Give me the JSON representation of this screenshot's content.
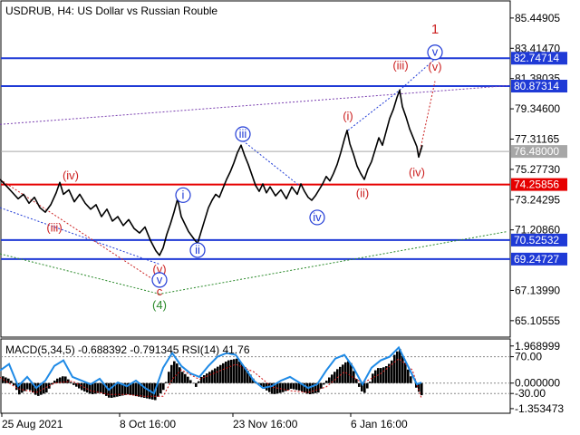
{
  "chart_data": [
    {
      "type": "line",
      "title": "USDRUB, H4:  US Dollar vs Russian Rouble",
      "ylim": [
        64.0,
        86.6
      ],
      "grid": false,
      "y_ticks": [
        "85.44905",
        "83.41470",
        "81.38035",
        "79.34600",
        "77.31165",
        "75.27730",
        "73.24295",
        "71.20860",
        "67.13990",
        "65.10555"
      ],
      "x_ticks": [
        "25 Aug 2021",
        "8 Oct 16:00",
        "23 Nov 16:00",
        "6 Jan 16:00"
      ],
      "series": [
        {
          "values": [
            [
              0,
              74.6
            ],
            [
              8,
              74.1
            ],
            [
              14,
              73.7
            ],
            [
              20,
              73.3
            ],
            [
              26,
              73.6
            ],
            [
              32,
              73.0
            ],
            [
              38,
              73.4
            ],
            [
              44,
              72.7
            ],
            [
              50,
              72.4
            ],
            [
              56,
              72.9
            ],
            [
              62,
              73.7
            ],
            [
              66,
              74.4
            ],
            [
              70,
              73.6
            ],
            [
              76,
              73.9
            ],
            [
              82,
              73.1
            ],
            [
              88,
              73.6
            ],
            [
              94,
              73.0
            ],
            [
              100,
              72.6
            ],
            [
              106,
              72.9
            ],
            [
              112,
              72.1
            ],
            [
              118,
              72.6
            ],
            [
              124,
              71.8
            ],
            [
              130,
              72.1
            ],
            [
              136,
              71.5
            ],
            [
              142,
              71.9
            ],
            [
              148,
              71.3
            ],
            [
              154,
              71.0
            ],
            [
              160,
              71.4
            ],
            [
              166,
              70.5
            ],
            [
              172,
              69.8
            ],
            [
              176,
              69.5
            ],
            [
              180,
              70.0
            ],
            [
              184,
              70.9
            ],
            [
              188,
              71.6
            ],
            [
              192,
              72.4
            ],
            [
              196,
              73.3
            ],
            [
              200,
              72.1
            ],
            [
              204,
              71.6
            ],
            [
              208,
              71.1
            ],
            [
              214,
              70.6
            ],
            [
              218,
              70.3
            ],
            [
              222,
              71.1
            ],
            [
              226,
              71.9
            ],
            [
              230,
              72.7
            ],
            [
              234,
              73.2
            ],
            [
              238,
              73.6
            ],
            [
              242,
              73.4
            ],
            [
              246,
              74.0
            ],
            [
              250,
              74.6
            ],
            [
              254,
              75.1
            ],
            [
              258,
              75.7
            ],
            [
              262,
              76.4
            ],
            [
              266,
              76.9
            ],
            [
              270,
              76.2
            ],
            [
              274,
              75.6
            ],
            [
              278,
              74.9
            ],
            [
              282,
              74.2
            ],
            [
              286,
              73.8
            ],
            [
              290,
              74.3
            ],
            [
              294,
              73.7
            ],
            [
              298,
              74.1
            ],
            [
              304,
              73.5
            ],
            [
              310,
              73.9
            ],
            [
              316,
              73.3
            ],
            [
              322,
              74.1
            ],
            [
              328,
              73.6
            ],
            [
              332,
              74.3
            ],
            [
              336,
              73.8
            ],
            [
              340,
              73.4
            ],
            [
              344,
              73.2
            ],
            [
              348,
              73.5
            ],
            [
              352,
              73.9
            ],
            [
              356,
              74.3
            ],
            [
              360,
              74.8
            ],
            [
              364,
              74.5
            ],
            [
              368,
              75.0
            ],
            [
              372,
              75.6
            ],
            [
              376,
              76.4
            ],
            [
              380,
              77.3
            ],
            [
              383,
              77.9
            ],
            [
              386,
              77.0
            ],
            [
              390,
              76.3
            ],
            [
              394,
              75.5
            ],
            [
              398,
              75.0
            ],
            [
              402,
              74.6
            ],
            [
              406,
              75.3
            ],
            [
              410,
              75.8
            ],
            [
              414,
              76.6
            ],
            [
              418,
              77.4
            ],
            [
              422,
              76.9
            ],
            [
              426,
              77.8
            ],
            [
              430,
              78.7
            ],
            [
              434,
              79.3
            ],
            [
              438,
              80.1
            ],
            [
              441,
              80.6
            ],
            [
              444,
              79.5
            ],
            [
              448,
              78.8
            ],
            [
              452,
              78.0
            ],
            [
              456,
              77.4
            ],
            [
              460,
              76.8
            ],
            [
              462,
              76.1
            ],
            [
              466,
              76.9
            ]
          ]
        }
      ],
      "horizontal_levels": [
        {
          "value": 82.74714,
          "label": "82.74714",
          "color": "#1f3ad6"
        },
        {
          "value": 80.87314,
          "label": "80.87314",
          "color": "#1f3ad6"
        },
        {
          "value": 76.48,
          "label": "76.48000",
          "color": "#a7a7a7"
        },
        {
          "value": 74.25856,
          "label": "74.25856",
          "color": "#e60000"
        },
        {
          "value": 70.52532,
          "label": "70.52532",
          "color": "#1f3ad6"
        },
        {
          "value": 69.24727,
          "label": "69.24727",
          "color": "#1f3ad6"
        }
      ],
      "wave_labels": [
        {
          "text": "1",
          "color": "#cc2222",
          "x": 480,
          "y": 84.4
        },
        {
          "text": "(iii)",
          "color": "#cc2222",
          "x": 442,
          "y": 82.0
        },
        {
          "text": "(v)",
          "color": "#cc2222",
          "x": 480,
          "y": 81.9
        },
        {
          "text": "v",
          "color": "#1f3ad6",
          "circled": true,
          "x": 480,
          "y": 82.9
        },
        {
          "text": "(i)",
          "color": "#cc2222",
          "x": 384,
          "y": 78.6
        },
        {
          "text": "(ii)",
          "color": "#cc2222",
          "x": 400,
          "y": 73.4
        },
        {
          "text": "(iv)",
          "color": "#cc2222",
          "x": 460,
          "y": 74.8
        },
        {
          "text": "iii",
          "color": "#1f3ad6",
          "circled": true,
          "x": 268,
          "y": 77.4
        },
        {
          "text": "i",
          "color": "#1f3ad6",
          "circled": true,
          "x": 202,
          "y": 73.3
        },
        {
          "text": "ii",
          "color": "#1f3ad6",
          "circled": true,
          "x": 218,
          "y": 69.6
        },
        {
          "text": "iv",
          "color": "#1f3ad6",
          "circled": true,
          "x": 350,
          "y": 71.8
        },
        {
          "text": "(iv)",
          "color": "#cc2222",
          "x": 78,
          "y": 74.6
        },
        {
          "text": "(iii)",
          "color": "#cc2222",
          "x": 60,
          "y": 71.1
        },
        {
          "text": "(v)",
          "color": "#cc2222",
          "x": 176,
          "y": 68.3
        },
        {
          "text": "v",
          "color": "#1f3ad6",
          "circled": true,
          "x": 176,
          "y": 67.6
        },
        {
          "text": "c",
          "color": "#cc2222",
          "x": 176,
          "y": 66.8
        },
        {
          "text": "(4)",
          "color": "#2a8a2a",
          "x": 176,
          "y": 65.9
        }
      ],
      "wave_lines": [
        {
          "color": "#1f3ad6",
          "points": [
            [
              268,
              77.2
            ],
            [
              330,
              74.2
            ]
          ]
        },
        {
          "color": "#1f3ad6",
          "points": [
            [
              0,
              72.7
            ],
            [
              176,
              68.9
            ]
          ]
        },
        {
          "color": "#cc2222",
          "points": [
            [
              0,
              74.6
            ],
            [
              176,
              67.6
            ]
          ]
        },
        {
          "color": "#2a8a2a",
          "points": [
            [
              0,
              69.6
            ],
            [
              176,
              66.9
            ],
            [
              560,
              71.1
            ]
          ]
        },
        {
          "color": "#7a3fb0",
          "points": [
            [
              0,
              78.3
            ],
            [
              560,
              80.9
            ]
          ]
        },
        {
          "color": "#1f3ad6",
          "points": [
            [
              384,
              77.9
            ],
            [
              441,
              80.6
            ],
            [
              480,
              82.7
            ]
          ]
        },
        {
          "color": "#cc2222",
          "points": [
            [
              462,
              76.1
            ],
            [
              480,
              81.2
            ]
          ]
        }
      ]
    },
    {
      "type": "bar",
      "title": "MACD(5,34,5) -0.688392 -0.791345 RSI(14) 41.76",
      "ylim": [
        -1.55,
        2.15
      ],
      "y_ticks": [
        "1.968999",
        "70.00",
        "0.000000",
        "-30.00",
        "-1.353473"
      ],
      "macd_values": [
        [
          0,
          0.4
        ],
        [
          10,
          0.2
        ],
        [
          20,
          -0.6
        ],
        [
          30,
          -0.3
        ],
        [
          40,
          -0.7
        ],
        [
          50,
          -0.5
        ],
        [
          60,
          0.2
        ],
        [
          70,
          0.4
        ],
        [
          80,
          -0.1
        ],
        [
          90,
          -0.4
        ],
        [
          100,
          -0.6
        ],
        [
          110,
          -0.5
        ],
        [
          120,
          -0.8
        ],
        [
          130,
          -0.7
        ],
        [
          140,
          -0.6
        ],
        [
          150,
          -0.7
        ],
        [
          160,
          -0.8
        ],
        [
          170,
          -0.9
        ],
        [
          180,
          -0.3
        ],
        [
          185,
          0.6
        ],
        [
          190,
          1.2
        ],
        [
          195,
          1.0
        ],
        [
          200,
          0.6
        ],
        [
          205,
          0.4
        ],
        [
          210,
          0.1
        ],
        [
          215,
          -0.2
        ],
        [
          220,
          0.3
        ],
        [
          230,
          0.6
        ],
        [
          240,
          0.9
        ],
        [
          250,
          1.2
        ],
        [
          260,
          1.3
        ],
        [
          270,
          0.8
        ],
        [
          280,
          0.1
        ],
        [
          290,
          -0.3
        ],
        [
          300,
          -0.6
        ],
        [
          310,
          -0.5
        ],
        [
          320,
          -0.3
        ],
        [
          330,
          -0.4
        ],
        [
          340,
          -0.6
        ],
        [
          350,
          -0.5
        ],
        [
          360,
          0.2
        ],
        [
          370,
          0.7
        ],
        [
          380,
          1.1
        ],
        [
          385,
          1.2
        ],
        [
          390,
          0.5
        ],
        [
          395,
          -0.2
        ],
        [
          400,
          -0.6
        ],
        [
          405,
          -0.2
        ],
        [
          410,
          0.5
        ],
        [
          415,
          0.8
        ],
        [
          420,
          0.8
        ],
        [
          425,
          0.9
        ],
        [
          430,
          1.1
        ],
        [
          435,
          1.6
        ],
        [
          440,
          1.8
        ],
        [
          445,
          1.2
        ],
        [
          450,
          0.6
        ],
        [
          455,
          0.0
        ],
        [
          460,
          -0.4
        ],
        [
          465,
          -0.7
        ]
      ],
      "signal_values": [
        [
          0,
          0.3
        ],
        [
          20,
          -0.3
        ],
        [
          40,
          -0.5
        ],
        [
          60,
          0.0
        ],
        [
          80,
          0.1
        ],
        [
          100,
          -0.4
        ],
        [
          120,
          -0.6
        ],
        [
          140,
          -0.6
        ],
        [
          160,
          -0.7
        ],
        [
          180,
          -0.7
        ],
        [
          190,
          0.2
        ],
        [
          200,
          0.7
        ],
        [
          220,
          0.2
        ],
        [
          240,
          0.6
        ],
        [
          260,
          1.0
        ],
        [
          280,
          0.6
        ],
        [
          300,
          -0.2
        ],
        [
          320,
          -0.4
        ],
        [
          340,
          -0.5
        ],
        [
          360,
          -0.2
        ],
        [
          380,
          0.6
        ],
        [
          400,
          0.0
        ],
        [
          420,
          0.5
        ],
        [
          440,
          1.3
        ],
        [
          455,
          0.7
        ],
        [
          465,
          -0.8
        ]
      ],
      "rsi_values": [
        [
          0,
          55
        ],
        [
          10,
          62
        ],
        [
          20,
          38
        ],
        [
          30,
          48
        ],
        [
          40,
          36
        ],
        [
          50,
          44
        ],
        [
          60,
          60
        ],
        [
          70,
          66
        ],
        [
          80,
          48
        ],
        [
          90,
          44
        ],
        [
          100,
          40
        ],
        [
          110,
          46
        ],
        [
          120,
          34
        ],
        [
          130,
          42
        ],
        [
          140,
          38
        ],
        [
          150,
          44
        ],
        [
          160,
          36
        ],
        [
          170,
          30
        ],
        [
          180,
          58
        ],
        [
          190,
          74
        ],
        [
          200,
          60
        ],
        [
          210,
          52
        ],
        [
          220,
          48
        ],
        [
          230,
          60
        ],
        [
          240,
          70
        ],
        [
          250,
          74
        ],
        [
          260,
          72
        ],
        [
          270,
          58
        ],
        [
          280,
          44
        ],
        [
          290,
          36
        ],
        [
          300,
          38
        ],
        [
          310,
          44
        ],
        [
          320,
          48
        ],
        [
          330,
          42
        ],
        [
          340,
          36
        ],
        [
          350,
          40
        ],
        [
          360,
          55
        ],
        [
          370,
          68
        ],
        [
          380,
          72
        ],
        [
          390,
          58
        ],
        [
          400,
          40
        ],
        [
          410,
          58
        ],
        [
          420,
          66
        ],
        [
          430,
          70
        ],
        [
          440,
          80
        ],
        [
          450,
          60
        ],
        [
          460,
          40
        ],
        [
          465,
          42
        ]
      ]
    }
  ]
}
